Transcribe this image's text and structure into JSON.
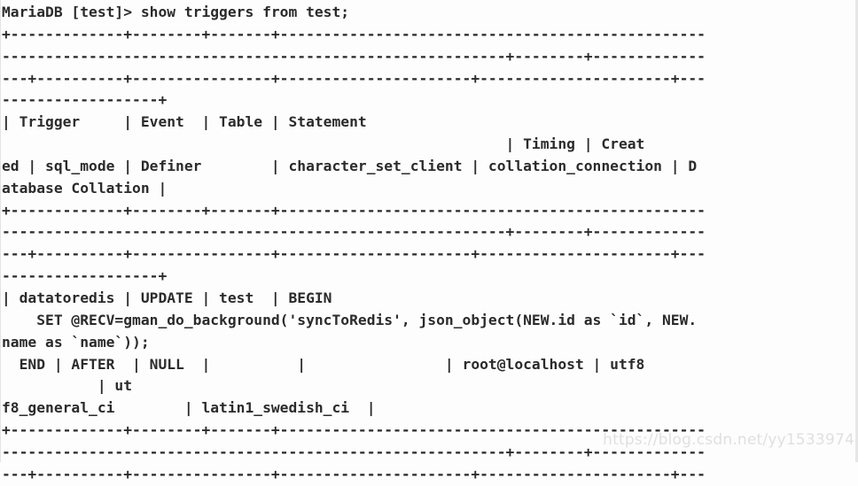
{
  "terminal": {
    "prompt": "MariaDB [test]> ",
    "command": "show triggers from test;",
    "wrap_columns": 82,
    "background_color": "#fdfdfd",
    "text_color": "#2b2b2b",
    "watermark": "https://blog.csdn.net/yy1533974",
    "watermark_color": "#e0e0e0",
    "result_table": {
      "columns": [
        {
          "name": "Trigger",
          "width": 11
        },
        {
          "name": "Event",
          "width": 6
        },
        {
          "name": "Table",
          "width": 5
        },
        {
          "name": "Statement",
          "width": 115
        },
        {
          "name": "Timing",
          "width": 6
        },
        {
          "name": "Created",
          "width": 19
        },
        {
          "name": "sql_mode",
          "width": 8
        },
        {
          "name": "Definer",
          "width": 14
        },
        {
          "name": "character_set_client",
          "width": 20
        },
        {
          "name": "collation_connection",
          "width": 20
        },
        {
          "name": "Database Collation",
          "width": 18
        }
      ],
      "rows": [
        {
          "Trigger": "datatoredis",
          "Event": "UPDATE",
          "Table": "test",
          "Statement": "BEGIN\n    SET @RECV=gman_do_background('syncToRedis', json_object(NEW.id as `id`, NEW.name as `name`));\n  END",
          "Timing": "AFTER",
          "Created": "NULL",
          "sql_mode": "",
          "Definer": "root@localhost",
          "character_set_client": "utf8",
          "collation_connection": "utf8_general_ci",
          "Database Collation": "latin1_swedish_ci"
        }
      ]
    },
    "lines": [
      "MariaDB [test]> show triggers from test;",
      "+-------------+--------+-------+-------------------------------------------------",
      "----------------------------------------------------------+--------+-------------",
      "---+----------+----------------+----------------------+----------------------+---",
      "------------------+",
      "| Trigger     | Event  | Table | Statement                                       ",
      "                                                          | Timing | Creat",
      "ed | sql_mode | Definer        | character_set_client | collation_connection | D",
      "atabase Collation |",
      "+-------------+--------+-------+-------------------------------------------------",
      "----------------------------------------------------------+--------+-------------",
      "---+----------+----------------+----------------------+----------------------+---",
      "------------------+",
      "| datatoredis | UPDATE | test  | BEGIN",
      "    SET @RECV=gman_do_background('syncToRedis', json_object(NEW.id as `id`, NEW.",
      "name as `name`));",
      "  END | AFTER  | NULL  |          |                | root@localhost | utf8      ",
      "           | ut",
      "f8_general_ci        | latin1_swedish_ci  |",
      "+-------------+--------+-------+-------------------------------------------------",
      "----------------------------------------------------------+--------+-------------",
      "---+----------+----------------+----------------------+----------------------+---"
    ]
  }
}
